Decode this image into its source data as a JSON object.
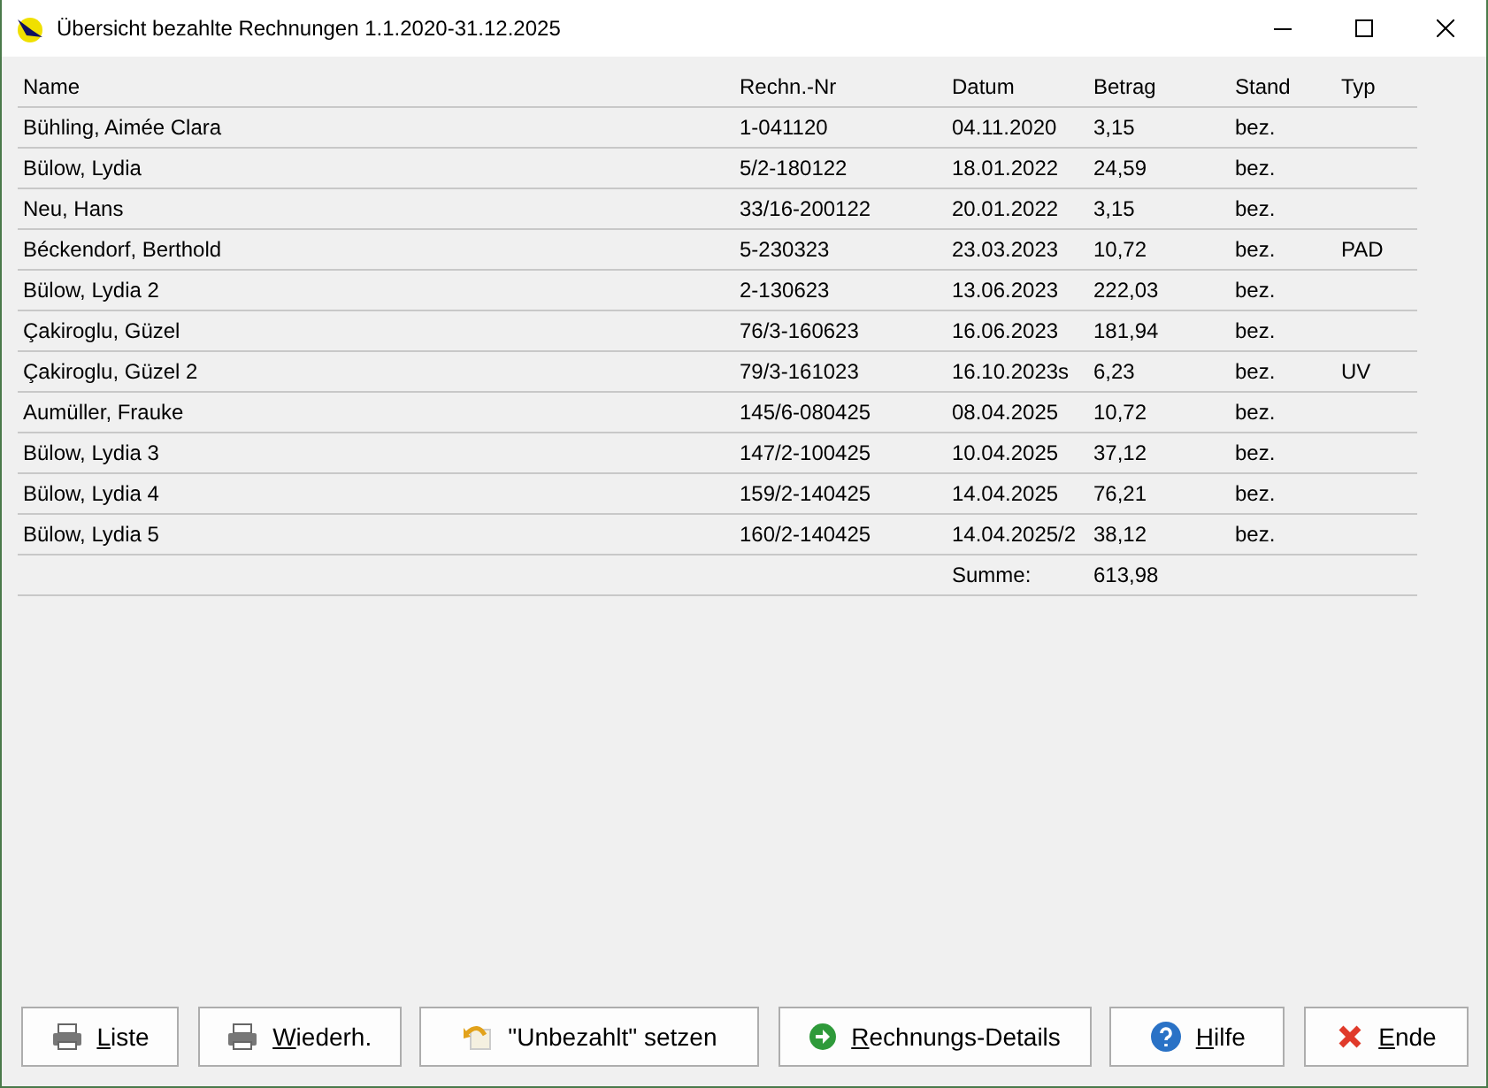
{
  "window": {
    "title": "Übersicht bezahlte Rechnungen 1.1.2020-31.12.2025"
  },
  "table": {
    "columns": [
      "Name",
      "Rechn.-Nr",
      "Datum",
      "Betrag",
      "Stand",
      "Typ"
    ],
    "rows": [
      [
        "Bühling, Aimée Clara",
        "1-041120",
        "04.11.2020",
        "3,15",
        "bez.",
        ""
      ],
      [
        "Bülow, Lydia",
        "5/2-180122",
        "18.01.2022",
        "24,59",
        "bez.",
        ""
      ],
      [
        "Neu, Hans",
        "33/16-200122",
        "20.01.2022",
        "3,15",
        "bez.",
        ""
      ],
      [
        "Béckendorf, Berthold",
        "5-230323",
        "23.03.2023",
        "10,72",
        "bez.",
        "PAD"
      ],
      [
        "Bülow, Lydia 2",
        "2-130623",
        "13.06.2023",
        "222,03",
        "bez.",
        ""
      ],
      [
        "Çakiroglu, Güzel",
        "76/3-160623",
        "16.06.2023",
        "181,94",
        "bez.",
        ""
      ],
      [
        "Çakiroglu, Güzel 2",
        "79/3-161023",
        "16.10.2023s",
        "6,23",
        "bez.",
        "UV"
      ],
      [
        "Aumüller, Frauke",
        "145/6-080425",
        "08.04.2025",
        "10,72",
        "bez.",
        ""
      ],
      [
        "Bülow, Lydia 3",
        "147/2-100425",
        "10.04.2025",
        "37,12",
        "bez.",
        ""
      ],
      [
        "Bülow, Lydia 4",
        "159/2-140425",
        "14.04.2025",
        "76,21",
        "bez.",
        ""
      ],
      [
        "Bülow, Lydia 5",
        "160/2-140425",
        "14.04.2025/2",
        "38,12",
        "bez.",
        ""
      ]
    ],
    "sum_label": "Summe:",
    "sum_value": "613,98"
  },
  "buttons": [
    {
      "label": "Liste",
      "kind": "print",
      "underlined": true
    },
    {
      "label": "Wiederh.",
      "kind": "print",
      "underlined": true
    },
    {
      "label": "\"Unbezahlt\" setzen",
      "kind": "undo",
      "underlined": false
    },
    {
      "label": "Rechnungs-Details",
      "kind": "details",
      "underlined": true
    },
    {
      "label": "Hilfe",
      "kind": "help",
      "underlined": true
    },
    {
      "label": "Ende",
      "kind": "exit",
      "underlined": true
    }
  ]
}
